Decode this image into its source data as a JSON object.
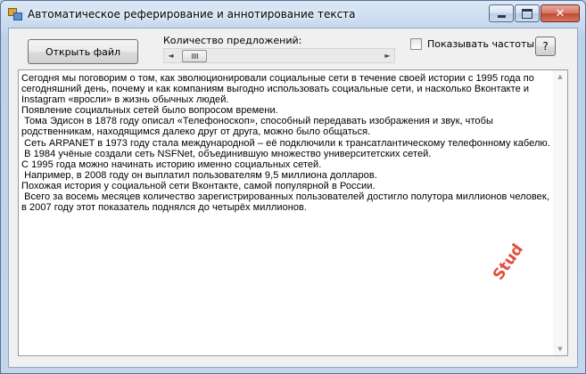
{
  "window": {
    "title": "Автоматическое реферирование и аннотирование текста",
    "caption_buttons": {
      "minimize_icon": "minimize-icon",
      "maximize_icon": "maximize-icon",
      "close_icon": "close-icon",
      "close_glyph": "✕"
    }
  },
  "toolbar": {
    "open_file_label": "Открыть файл",
    "sentence_count_label": "Количество предложений:",
    "scroll_left_glyph": "◄",
    "scroll_right_glyph": "►",
    "show_frequencies_label": "Показывать частоты",
    "show_frequencies_checked": false,
    "help_label": "?"
  },
  "document": {
    "lines": [
      "Сегодня мы поговорим о том, как эволюционировали социальные сети в течение своей истории с 1995 года по",
      "сегодняшний день, почему и как компаниям выгодно использовать социальные сети, и насколько Вконтакте и",
      "Instagram «вросли» в жизнь обычных людей.",
      "Появление социальных сетей было вопросом времени.",
      " Тома Эдисон в 1878 году описал «Телефоноскоп», способный передавать изображения и звук, чтобы",
      "родственникам, находящимся далеко друг от друга, можно было общаться.",
      " Сеть ARPANET в 1973 году стала международной – её подключили к трансатлантическому телефонному кабелю.",
      " В 1984 учёные создали сеть NSFNet, объединившую множество университетских сетей.",
      "С 1995 года можно начинать историю именно социальных сетей.",
      " Например, в 2008 году он выплатил пользователям 9,5 миллиона долларов.",
      "Похожая история у социальной сети Вконтакте, самой популярной в России.",
      " Всего за восемь месяцев количество зарегистрированных пользователей достигло полутора миллионов человек,",
      "в 2007 году этот показатель поднялся до четырёх миллионов."
    ],
    "scroll_up_glyph": "▲",
    "scroll_down_glyph": "▼"
  },
  "watermark": {
    "text": "Stud",
    "color": "#e23b2b"
  }
}
